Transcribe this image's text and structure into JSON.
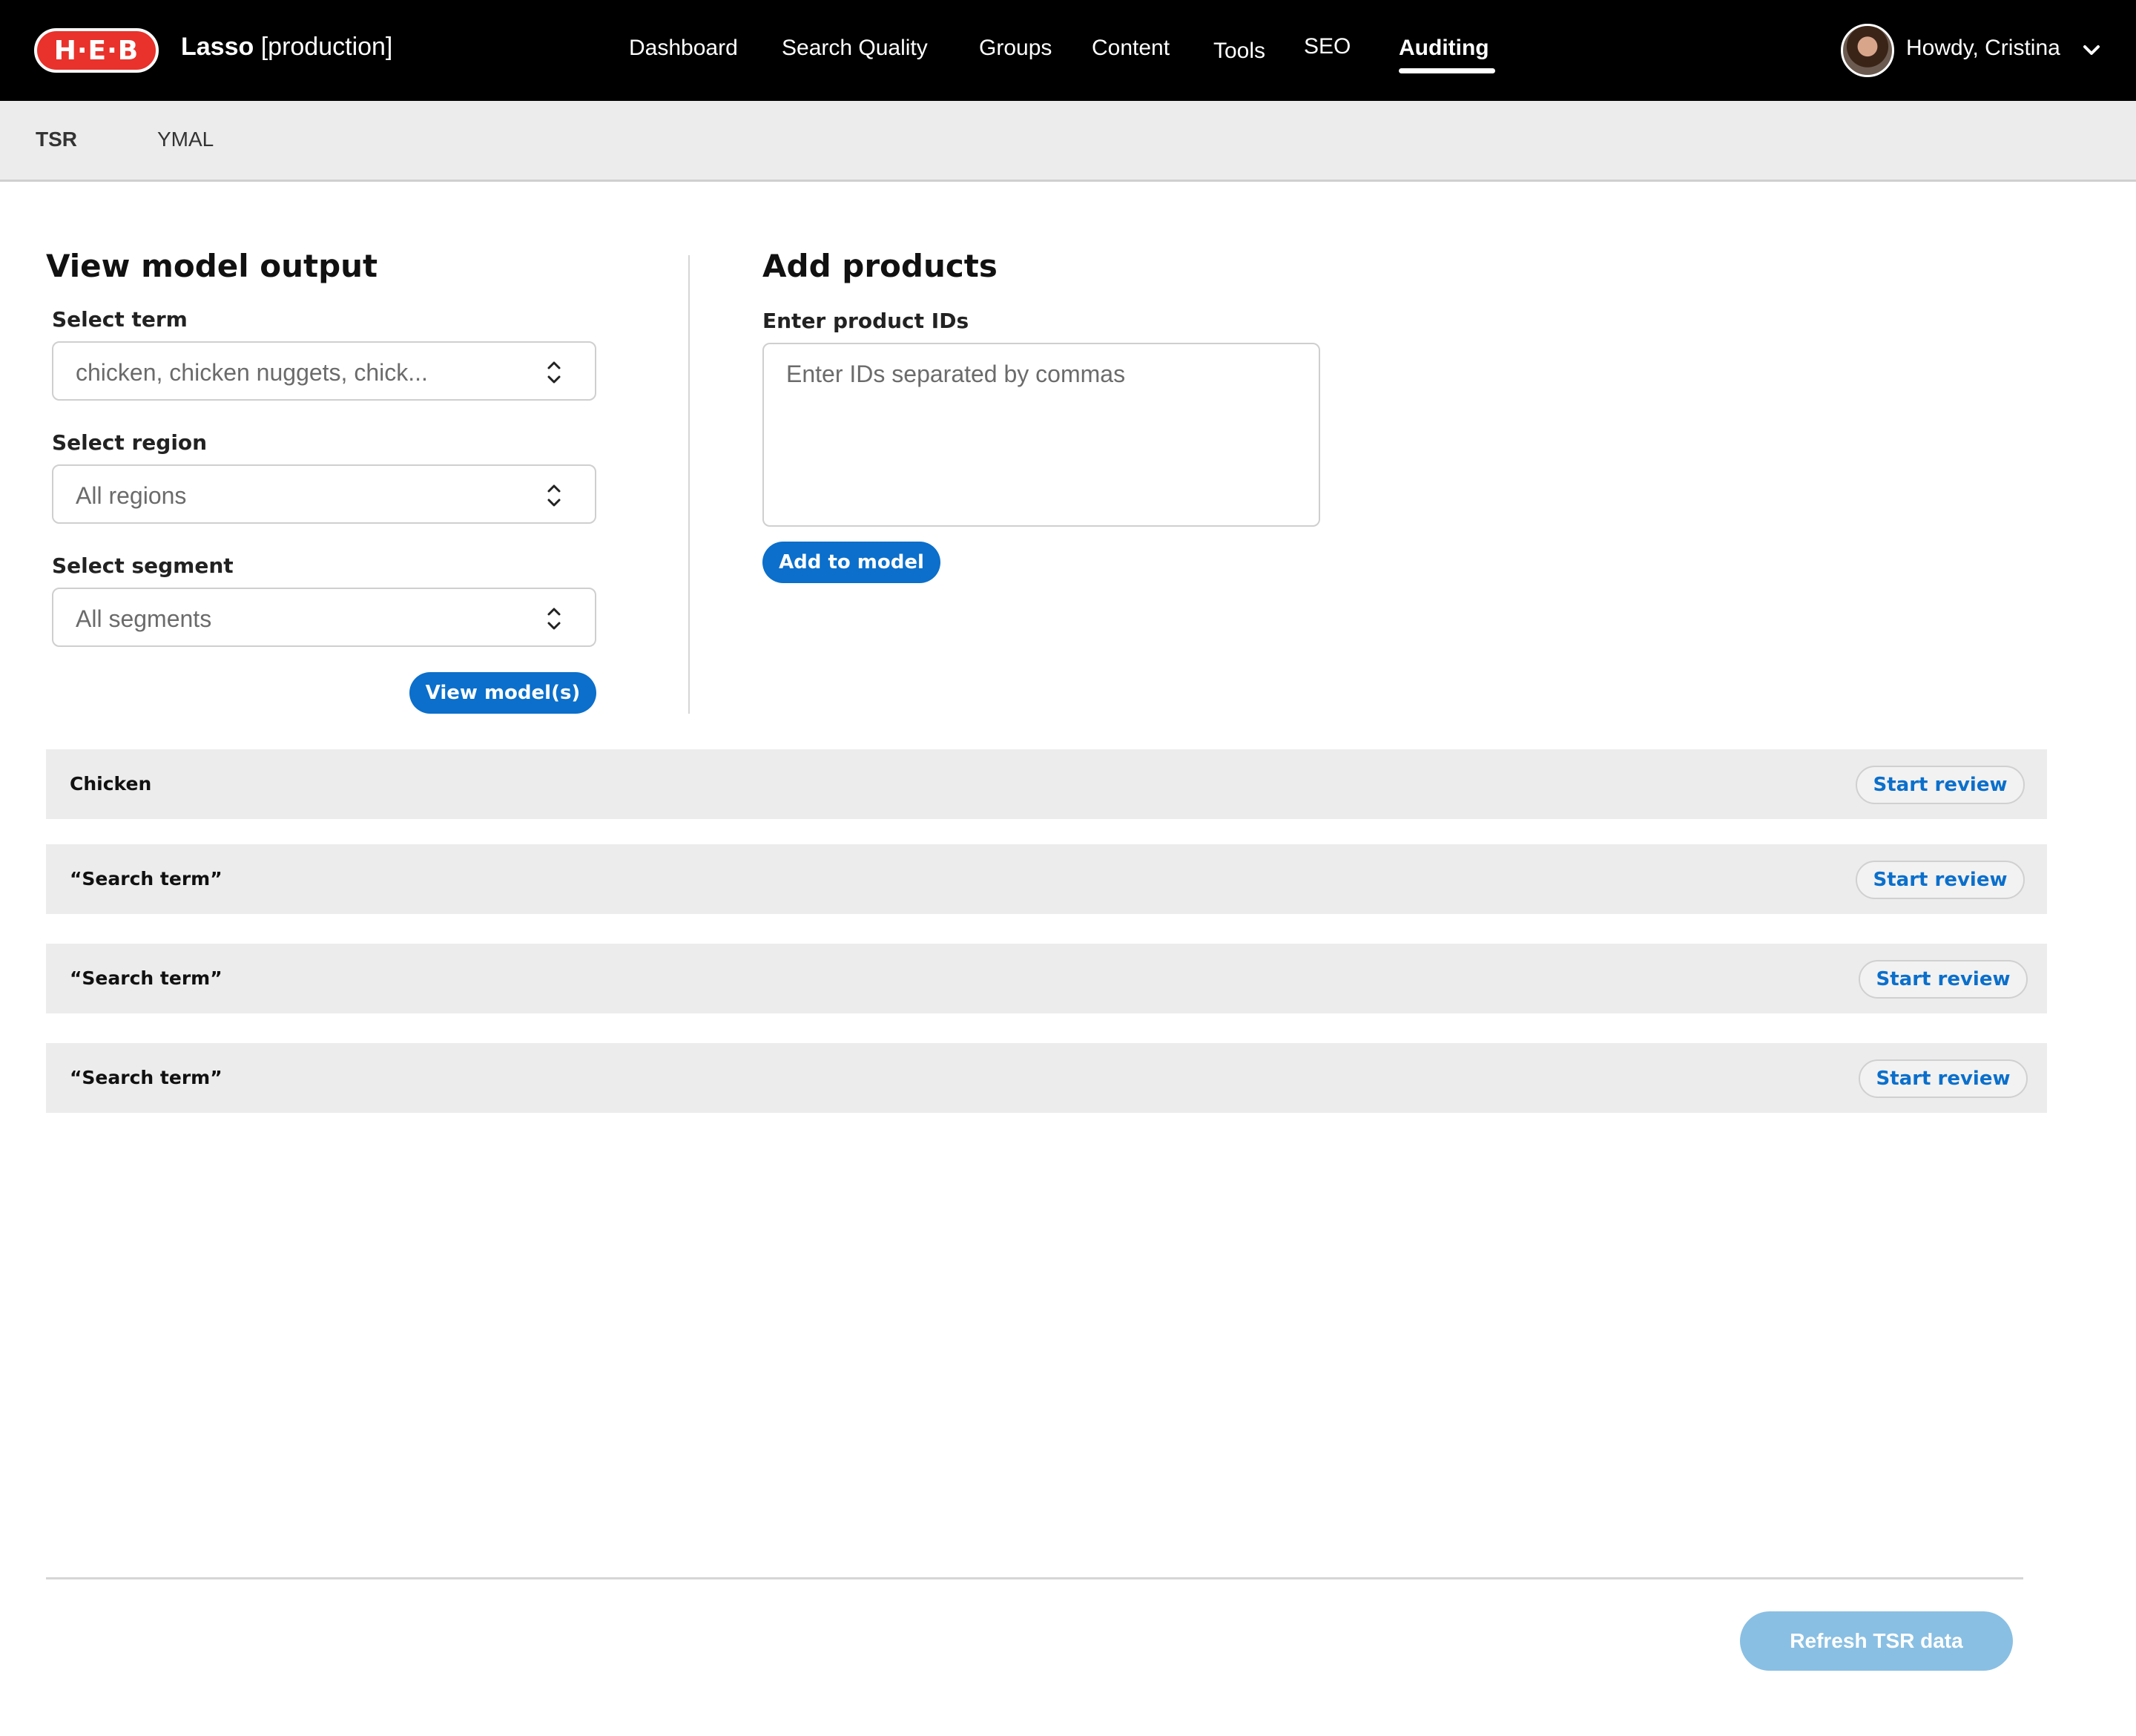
{
  "header": {
    "logo_text": "H·E·B",
    "app_name_bold": "Lasso",
    "app_env": " [production]",
    "nav": [
      {
        "label": "Dashboard"
      },
      {
        "label": "Search Quality"
      },
      {
        "label": "Groups"
      },
      {
        "label": "Content"
      },
      {
        "label": "Tools"
      },
      {
        "label": "SEO"
      },
      {
        "label": "Auditing",
        "active": true
      }
    ],
    "greeting": "Howdy, Cristina",
    "avatar_icon": "user-avatar",
    "dropdown_icon": "chevron-down-icon"
  },
  "subnav": {
    "tabs": [
      {
        "label": "TSR",
        "active": true
      },
      {
        "label": "YMAL"
      }
    ]
  },
  "view_model": {
    "title": "View model output",
    "term_label": "Select term",
    "term_value": "chicken, chicken nuggets, chick...",
    "region_label": "Select region",
    "region_value": "All regions",
    "segment_label": "Select segment",
    "segment_value": "All segments",
    "button": "View model(s)"
  },
  "add_products": {
    "title": "Add products",
    "ids_label": "Enter product IDs",
    "ids_placeholder": "Enter IDs separated by commas",
    "button": "Add to model"
  },
  "rows": [
    {
      "term": "Chicken",
      "action": "Start review"
    },
    {
      "term": "“Search term”",
      "action": "Start review"
    },
    {
      "term": "“Search term”",
      "action": "Start review"
    },
    {
      "term": "“Search term”",
      "action": "Start review"
    }
  ],
  "footer": {
    "refresh_button": "Refresh TSR data"
  },
  "colors": {
    "topbar": "#000000",
    "accent_blue": "#0b6fcb",
    "disabled_blue": "#89bfe3",
    "logo_red": "#e8322b",
    "row_bg": "#ececec"
  }
}
